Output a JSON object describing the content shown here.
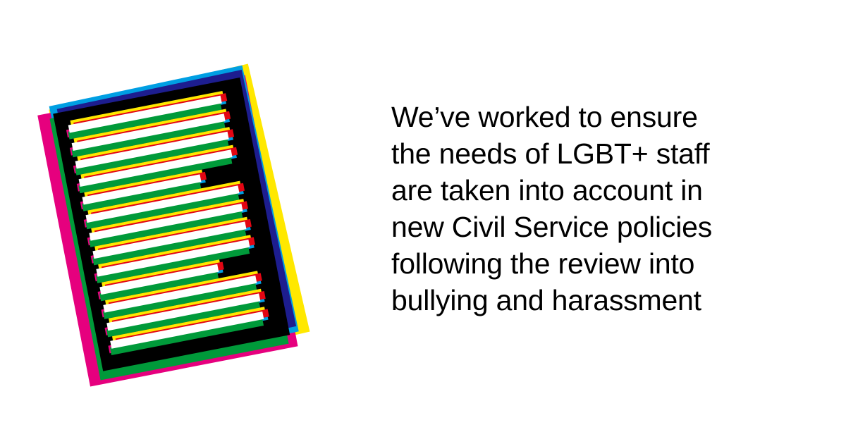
{
  "statement": {
    "lines": [
      "We’ve worked to ensure",
      "the needs of LGBT+ staff",
      "are taken into account in",
      "new Civil Service policies",
      "following the review into",
      "bullying and harassment"
    ]
  },
  "illustration": {
    "icon": "document-icon",
    "colors": {
      "yellow": "#ffe800",
      "magenta": "#e6007e",
      "blue": "#009fe3",
      "green": "#009a3a",
      "navy": "#1d1d8f",
      "red": "#e30613",
      "black": "#000000",
      "white": "#ffffff"
    }
  }
}
